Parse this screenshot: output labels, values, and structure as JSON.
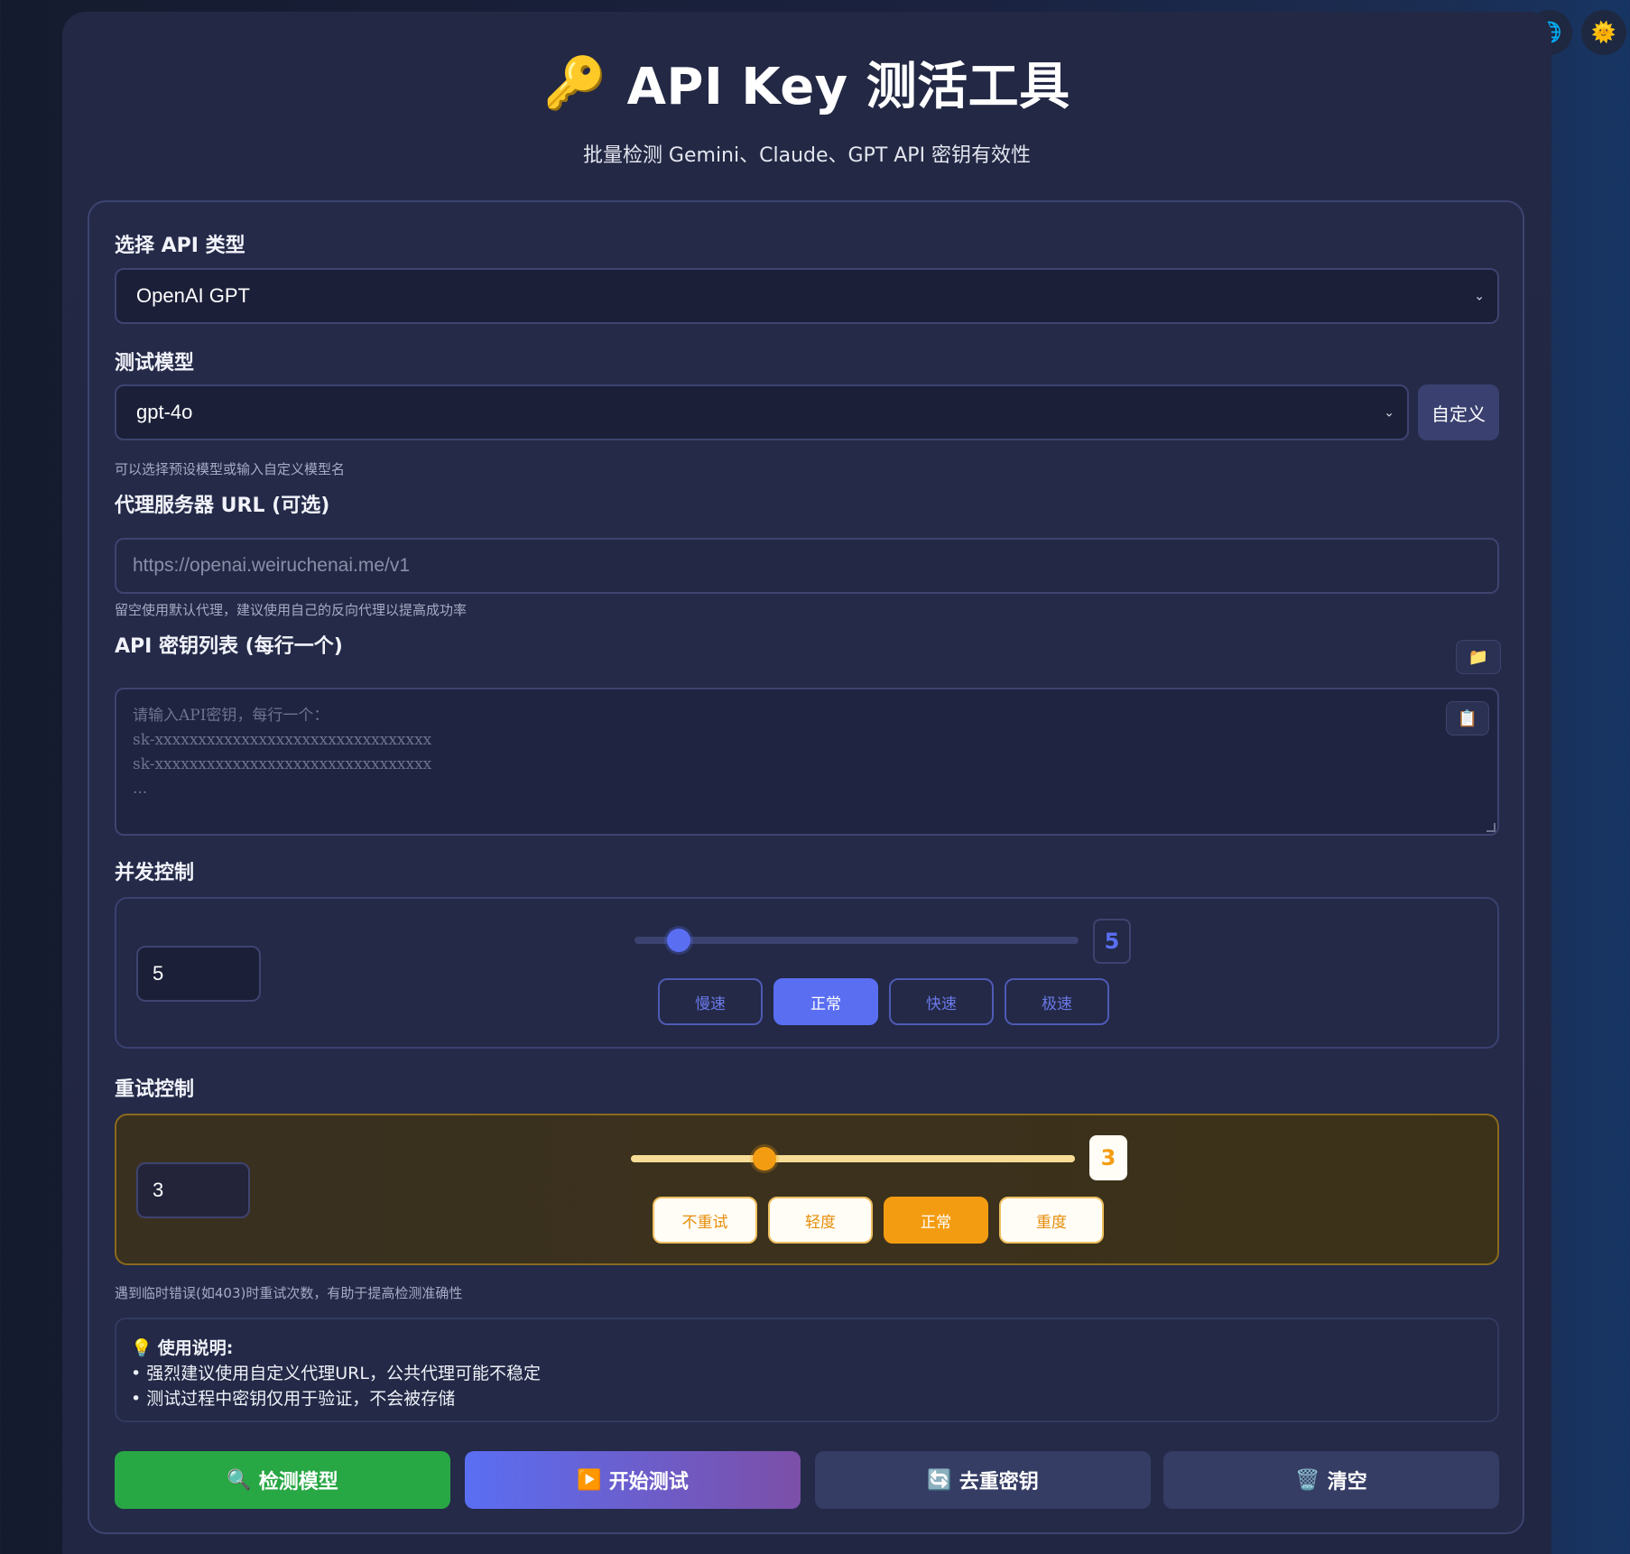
{
  "top_buttons": {
    "language_icon": "globe-icon",
    "theme_icon": "sun-icon"
  },
  "header": {
    "icon": "key-icon",
    "title": "API Key 测活工具",
    "subtitle": "批量检测 Gemini、Claude、GPT API 密钥有效性"
  },
  "api_type": {
    "label": "选择 API 类型",
    "selected": "OpenAI GPT"
  },
  "model": {
    "label": "测试模型",
    "selected": "gpt-4o",
    "custom_button": "自定义",
    "hint": "可以选择预设模型或输入自定义模型名"
  },
  "proxy": {
    "label": "代理服务器 URL (可选)",
    "placeholder": "https://openai.weiruchenai.me/v1",
    "hint": "留空使用默认代理，建议使用自己的反向代理以提高成功率"
  },
  "keys": {
    "label": "API 密钥列表 (每行一个)",
    "placeholder": "请输入API密钥，每行一个：\nsk-xxxxxxxxxxxxxxxxxxxxxxxxxxxxxxxx\nsk-xxxxxxxxxxxxxxxxxxxxxxxxxxxxxxxx\n...",
    "folder_icon": "folder-icon",
    "paste_icon": "clipboard-icon"
  },
  "concurrency": {
    "label": "并发控制",
    "value": "5",
    "slider_fraction": 0.1,
    "badge": "5",
    "presets": [
      "慢速",
      "正常",
      "快速",
      "极速"
    ],
    "active_index": 1
  },
  "retry": {
    "label": "重试控制",
    "value": "3",
    "slider_fraction": 0.3,
    "badge": "3",
    "presets": [
      "不重试",
      "轻度",
      "正常",
      "重度"
    ],
    "active_index": 2,
    "hint": "遇到临时错误(如403)时重试次数，有助于提高检测准确性"
  },
  "notes": {
    "icon": "lightbulb-icon",
    "title": "使用说明:",
    "items": [
      "• 强烈建议使用自定义代理URL，公共代理可能不稳定",
      "• 测试过程中密钥仅用于验证，不会被存储"
    ]
  },
  "actions": {
    "detect": {
      "label": "检测模型",
      "icon": "magnifier-icon"
    },
    "start": {
      "label": "开始测试",
      "icon": "play-icon"
    },
    "dedupe": {
      "label": "去重密钥",
      "icon": "refresh-icon"
    },
    "clear": {
      "label": "清空",
      "icon": "trash-icon"
    }
  },
  "colors": {
    "primary": "#5a6ef2",
    "success": "#28a745",
    "warning": "#f39c12",
    "start_gradient_end": "#7c4fa8"
  }
}
